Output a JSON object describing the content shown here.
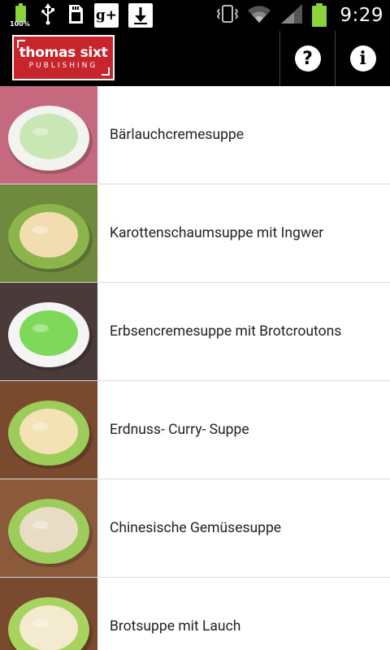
{
  "status_bar": {
    "battery_small_percent": "100%",
    "icons_left": [
      "battery-icon",
      "usb-icon",
      "sd-card-icon",
      "google-plus-icon",
      "download-icon"
    ],
    "icons_right": [
      "vibrate-icon",
      "wifi-icon",
      "signal-icon",
      "battery-icon"
    ],
    "time": "9:29",
    "gplus_label": "g+"
  },
  "action_bar": {
    "logo_line1": "thomas sixt",
    "logo_line2": "PUBLISHING",
    "help_label": "?",
    "info_label": "i",
    "accent_color": "#c8242b"
  },
  "recipes": [
    {
      "title": "Bärlauchcremesuppe",
      "thumb_bg": "#c56a7e",
      "bowl": "#f3f3ef",
      "soup": "#c9e7b5"
    },
    {
      "title": "Karottenschaumsuppe mit Ingwer",
      "thumb_bg": "#6f8a3e",
      "bowl": "#8bb44a",
      "soup": "#f1ddb0"
    },
    {
      "title": "Erbsencremesuppe mit Brotcroutons",
      "thumb_bg": "#4a3a3a",
      "bowl": "#f4f4f4",
      "soup": "#7ed85a"
    },
    {
      "title": "Erdnuss- Curry- Suppe",
      "thumb_bg": "#7a4a2e",
      "bowl": "#9ccc5a",
      "soup": "#f2e2b4"
    },
    {
      "title": "Chinesische Gemüsesuppe",
      "thumb_bg": "#8a5a3a",
      "bowl": "#9ccc5a",
      "soup": "#e8dcc4"
    },
    {
      "title": "Brotsuppe mit Lauch",
      "thumb_bg": "#7a4a2e",
      "bowl": "#a9d35f",
      "soup": "#f4ead0"
    }
  ]
}
